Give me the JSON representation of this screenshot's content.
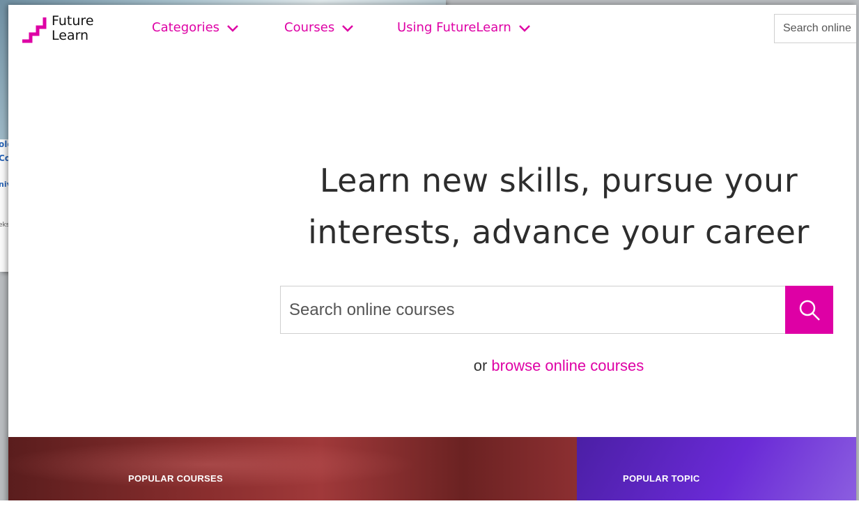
{
  "background_window": {
    "lines": [
      "olo",
      "Co",
      "niv",
      "eks"
    ]
  },
  "brand": {
    "name_line1": "Future",
    "name_line2": "Learn",
    "accent": "#de00a5"
  },
  "nav": {
    "items": [
      {
        "label": "Categories"
      },
      {
        "label": "Courses"
      },
      {
        "label": "Using FutureLearn"
      }
    ],
    "search_placeholder": "Search online"
  },
  "hero": {
    "title_line1": "Learn new skills, pursue your",
    "title_line2": "interests, advance your career",
    "search_placeholder": "Search online courses",
    "or_text": "or",
    "browse_link": "browse online courses"
  },
  "sections": {
    "popular_courses_label": "POPULAR COURSES",
    "popular_topic_label": "POPULAR TOPIC"
  },
  "icons": {
    "nav_chevron": "chevron-down-icon",
    "search": "search-icon",
    "logo": "futurelearn-logo-mark"
  }
}
